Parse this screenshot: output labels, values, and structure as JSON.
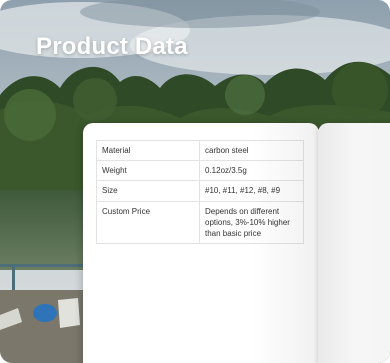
{
  "title": "Product Data",
  "spec_rows": [
    {
      "label": "Material",
      "value": "carbon steel"
    },
    {
      "label": "Weight",
      "value": "0.12oz/3.5g"
    },
    {
      "label": "Size",
      "value": "#10, #11, #12, #8, #9"
    },
    {
      "label": "Custom Price",
      "value": "Depends on different options, 3%-10% higher than basic price"
    }
  ]
}
